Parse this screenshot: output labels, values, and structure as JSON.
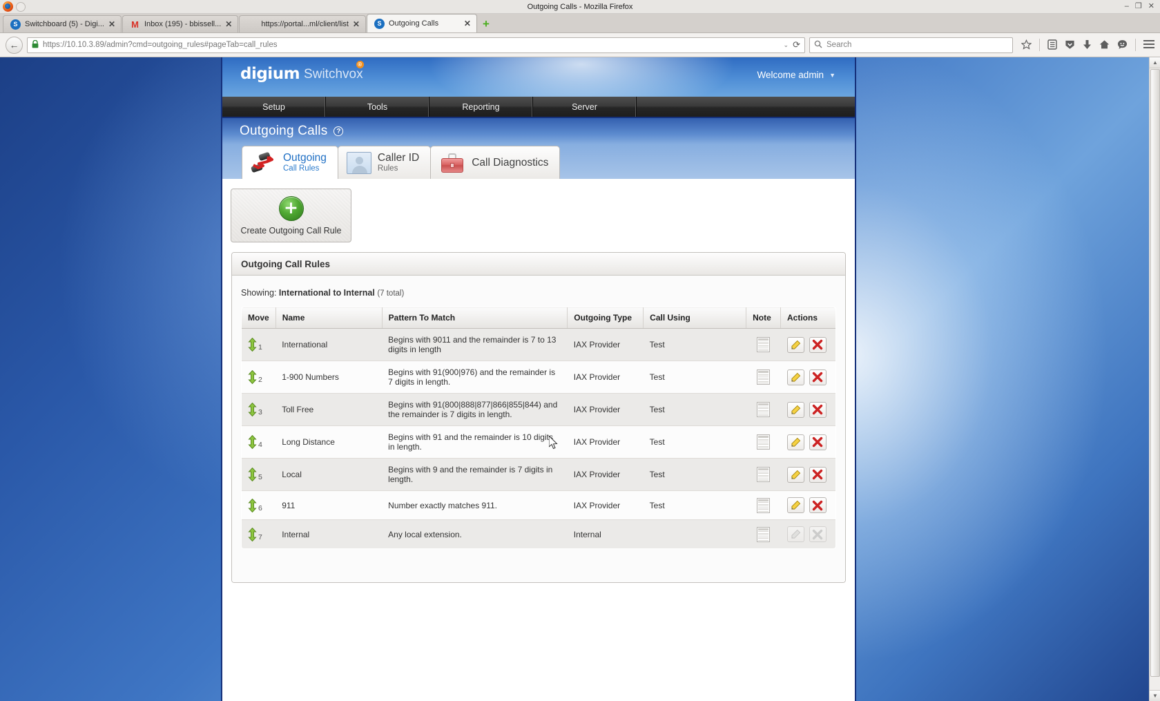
{
  "window": {
    "title": "Outgoing Calls - Mozilla Firefox",
    "minimize": "–",
    "maximize": "❐",
    "close": "✕"
  },
  "browser": {
    "tabs": [
      {
        "label": "Switchboard (5) - Digi...",
        "favicon": "switchvox-icon",
        "favicon_text": "S",
        "active": false,
        "close": "✕"
      },
      {
        "label": "Inbox (195) - bbissell...",
        "favicon": "gmail-icon",
        "favicon_text": "M",
        "active": false,
        "close": "✕"
      },
      {
        "label": "https://portal...ml/client/list",
        "favicon": "blank-icon",
        "favicon_text": "",
        "active": false,
        "close": "✕"
      },
      {
        "label": "Outgoing Calls",
        "favicon": "switchvox-icon",
        "favicon_text": "S",
        "active": true,
        "close": "✕"
      }
    ],
    "new_tab_label": "+",
    "back_arrow": "←",
    "url": {
      "lock": "ὑ2",
      "prefix": "https://",
      "host": "10.10.3.89",
      "suffix": "/admin?cmd=outgoing_rules#pageTab=call_rules",
      "full": "https://10.10.3.89/admin?cmd=outgoing_rules#pageTab=call_rules",
      "dropdown": "⌄",
      "reload": "⟳"
    },
    "search": {
      "placeholder": "Search",
      "icon": "search-icon",
      "value": ""
    },
    "toolbar_icons": [
      "bookmark-star-icon",
      "reader-list-icon",
      "shield-save-icon",
      "downloads-arrow-icon",
      "home-icon",
      "chat-smiley-icon",
      "hamburger-menu-icon"
    ]
  },
  "app": {
    "brand": "digium",
    "brand_reg": "®",
    "product": "Switchvox",
    "welcome": "Welcome admin",
    "nav": [
      "Setup",
      "Tools",
      "Reporting",
      "Server"
    ],
    "page_title": "Outgoing Calls",
    "help_glyph": "?"
  },
  "page_tabs": [
    {
      "main": "Outgoing",
      "sub": "Call Rules",
      "icon": "outgoing-phones-icon",
      "active": true
    },
    {
      "main": "Caller ID",
      "sub": "Rules",
      "icon": "caller-id-person-icon",
      "active": false
    },
    {
      "main": "Call Diagnostics",
      "sub": "",
      "icon": "red-toolcase-icon",
      "active": false
    }
  ],
  "create_button": {
    "label": "Create Outgoing Call Rule",
    "icon": "green-plus-icon"
  },
  "panel": {
    "title": "Outgoing Call Rules",
    "showing_label": "Showing:",
    "showing_value": "International to Internal",
    "showing_total": "(7 total)",
    "columns": [
      "Move",
      "Name",
      "Pattern To Match",
      "Outgoing Type",
      "Call Using",
      "Note",
      "Actions"
    ],
    "rows": [
      {
        "index": "1",
        "name": "International",
        "pattern": "Begins with 9011 and the remainder is 7 to 13 digits in length",
        "outgoing_type": "IAX Provider",
        "call_using": "Test",
        "note_icon": "note-page-icon",
        "edit_icon": "pencil-edit-icon",
        "delete_icon": "red-x-delete-icon",
        "disabled": false
      },
      {
        "index": "2",
        "name": "1-900 Numbers",
        "pattern": "Begins with 91(900|976) and the remainder is 7 digits in length.",
        "outgoing_type": "IAX Provider",
        "call_using": "Test",
        "note_icon": "note-page-icon",
        "edit_icon": "pencil-edit-icon",
        "delete_icon": "red-x-delete-icon",
        "disabled": false
      },
      {
        "index": "3",
        "name": "Toll Free",
        "pattern": "Begins with 91(800|888|877|866|855|844) and the remainder is 7 digits in length.",
        "outgoing_type": "IAX Provider",
        "call_using": "Test",
        "note_icon": "note-page-icon",
        "edit_icon": "pencil-edit-icon",
        "delete_icon": "red-x-delete-icon",
        "disabled": false
      },
      {
        "index": "4",
        "name": "Long Distance",
        "pattern": "Begins with 91 and the remainder is 10 digits in length.",
        "outgoing_type": "IAX Provider",
        "call_using": "Test",
        "note_icon": "note-page-icon",
        "edit_icon": "pencil-edit-icon",
        "delete_icon": "red-x-delete-icon",
        "disabled": false
      },
      {
        "index": "5",
        "name": "Local",
        "pattern": "Begins with 9 and the remainder is 7 digits in length.",
        "outgoing_type": "IAX Provider",
        "call_using": "Test",
        "note_icon": "note-page-icon",
        "edit_icon": "pencil-edit-icon",
        "delete_icon": "red-x-delete-icon",
        "disabled": false
      },
      {
        "index": "6",
        "name": "911",
        "pattern": "Number exactly matches 911.",
        "outgoing_type": "IAX Provider",
        "call_using": "Test",
        "note_icon": "note-page-icon",
        "edit_icon": "pencil-edit-icon",
        "delete_icon": "red-x-delete-icon",
        "disabled": false
      },
      {
        "index": "7",
        "name": "Internal",
        "pattern": "Any local extension.",
        "outgoing_type": "Internal",
        "call_using": "",
        "note_icon": "note-page-icon",
        "edit_icon": "pencil-edit-icon",
        "delete_icon": "red-x-delete-icon",
        "disabled": true
      }
    ]
  },
  "colors": {
    "accent_blue": "#1f6fc4",
    "brand_orange": "#f3901d",
    "nav_dark": "#262626",
    "page_blue": "#3f76c4",
    "delete_red": "#cc2222",
    "plus_green": "#4fa832"
  }
}
